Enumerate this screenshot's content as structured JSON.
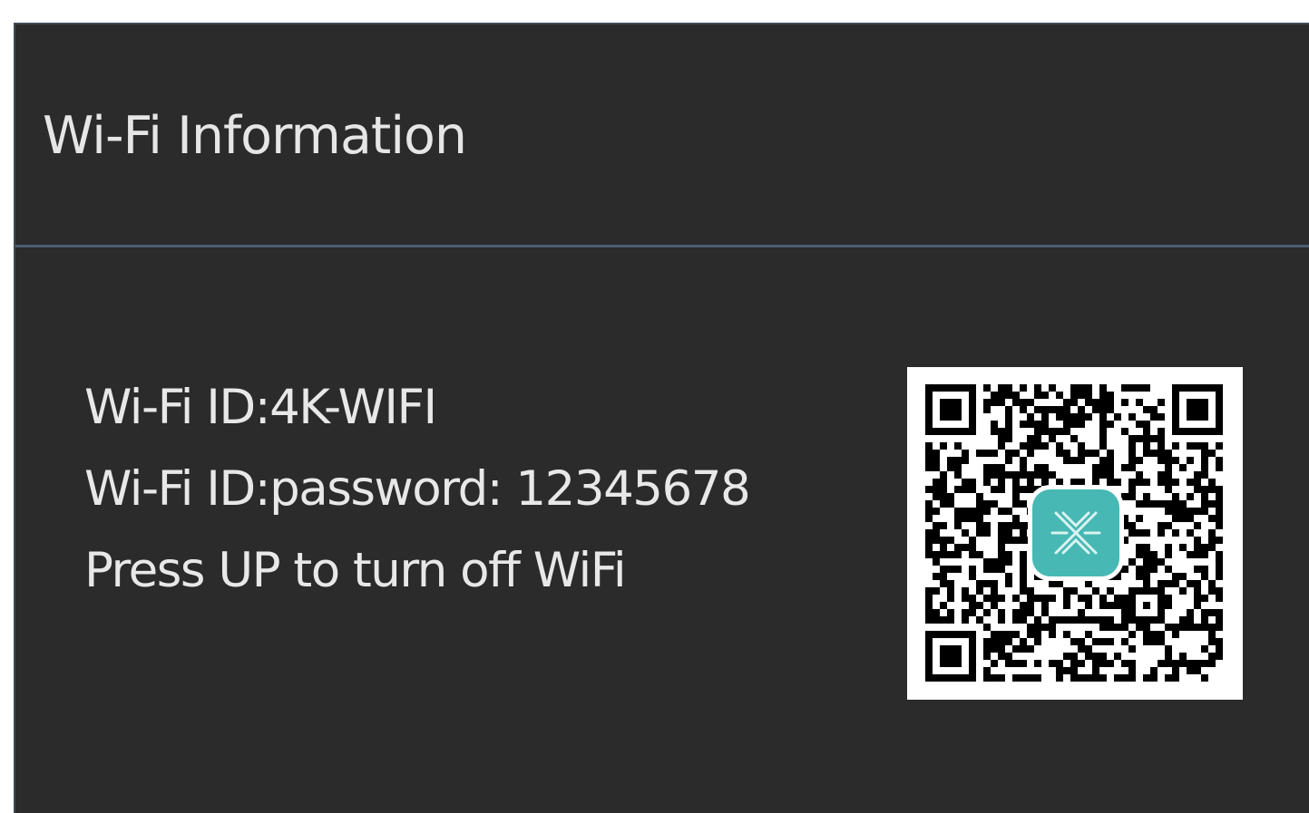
{
  "header": {
    "title": "Wi-Fi Information"
  },
  "wifi": {
    "id_line": "Wi-Fi ID:4K-WIFI",
    "password_line": "Wi-Fi ID:password: 12345678",
    "instruction_line": "Press UP to turn off WiFi"
  },
  "colors": {
    "background": "#2b2b2b",
    "text": "#e8e8e8",
    "header_divider": "#4a5e72",
    "qr_logo": "#47b8b4"
  },
  "icons": {
    "qr": "qr-code-icon",
    "app_logo": "app-logo-icon"
  }
}
